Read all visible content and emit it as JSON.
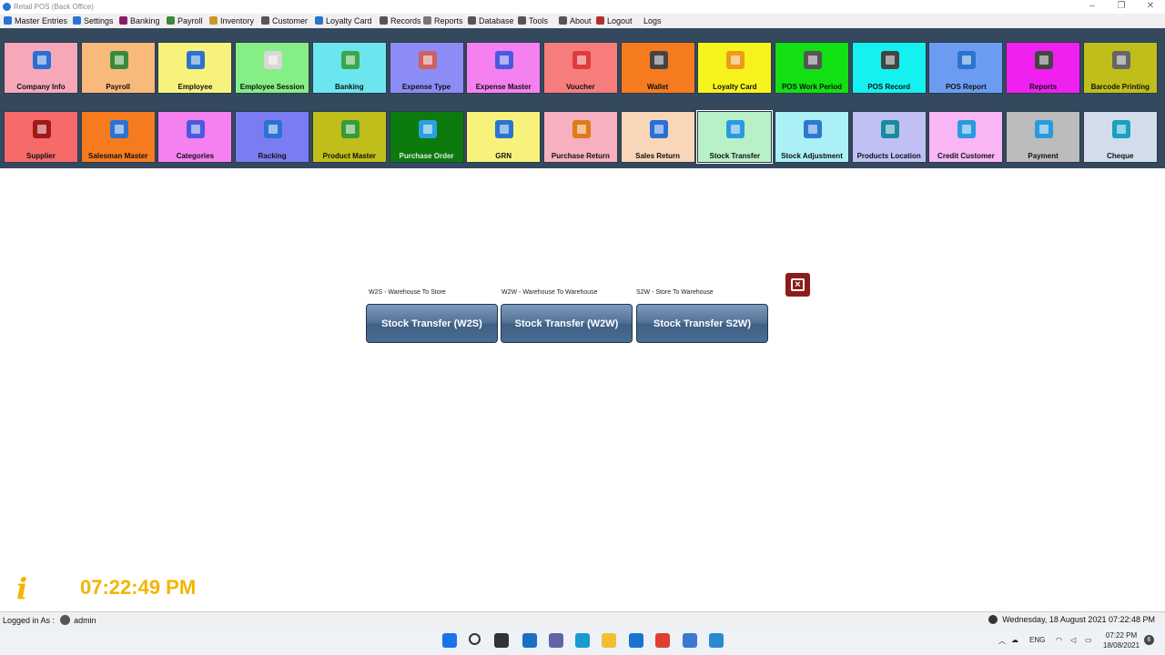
{
  "window": {
    "title": "Retail POS (Back Office)",
    "controls": [
      "–",
      "❐",
      "✕"
    ]
  },
  "menu": [
    {
      "label": "Master Entries",
      "icon": "globe-icon",
      "color": "#2a73d0"
    },
    {
      "label": "Settings",
      "icon": "globe-icon",
      "color": "#2a73d0"
    },
    {
      "label": "Banking",
      "icon": "bank-icon",
      "color": "#8b1c6a"
    },
    {
      "label": "Payroll",
      "icon": "payroll-icon",
      "color": "#3a8a3a"
    },
    {
      "label": "Inventory",
      "icon": "inventory-icon",
      "color": "#c79a2a"
    },
    {
      "label": "Customer",
      "icon": "customer-icon",
      "color": "#555555"
    },
    {
      "label": "Loyalty Card",
      "icon": "card-icon",
      "color": "#2a73d0"
    },
    {
      "label": "Records",
      "icon": "records-icon",
      "color": "#555555"
    },
    {
      "label": "Reports",
      "icon": "reports-icon",
      "color": "#777777"
    },
    {
      "label": "Database",
      "icon": "database-icon",
      "color": "#555555"
    },
    {
      "label": "Tools",
      "icon": "tools-icon",
      "color": "#555555"
    },
    {
      "label": "About",
      "icon": "about-icon",
      "color": "#555555"
    },
    {
      "label": "Logout",
      "icon": "logout-icon",
      "color": "#b03030"
    },
    {
      "label": "Logs",
      "icon": "",
      "color": ""
    }
  ],
  "tiles_row1": [
    {
      "label": "Company Info",
      "bg": "#f7a8b8",
      "icon": "building-icon",
      "ic": "#2a6fd6"
    },
    {
      "label": "Payroll",
      "bg": "#f9b97a",
      "icon": "money-envelope-icon",
      "ic": "#3a8a3a"
    },
    {
      "label": "Employee",
      "bg": "#f7f27c",
      "icon": "employee-add-icon",
      "ic": "#2a73d0"
    },
    {
      "label": "Employee Session",
      "bg": "#86ee86",
      "icon": "session-icon",
      "ic": "#d8d8d8"
    },
    {
      "label": "Banking",
      "bg": "#6be6ef",
      "icon": "dollar-icon",
      "ic": "#3aa84a"
    },
    {
      "label": "Expense Type",
      "bg": "#8c8cf7",
      "icon": "barcode-list-icon",
      "ic": "#d06060"
    },
    {
      "label": "Expense Master",
      "bg": "#f580f0",
      "icon": "list-icon",
      "ic": "#4a5ae0"
    },
    {
      "label": "Voucher",
      "bg": "#f77d7d",
      "icon": "gift-card-icon",
      "ic": "#e03a3a"
    },
    {
      "label": "Wallet",
      "bg": "#f57b1e",
      "icon": "wallet-icon",
      "ic": "#444444"
    },
    {
      "label": "Loyalty Card",
      "bg": "#f7f31c",
      "icon": "loyalty-card-icon",
      "ic": "#f09a1a"
    },
    {
      "label": "POS Work Period",
      "bg": "#12e012",
      "icon": "timer-icon",
      "ic": "#555555"
    },
    {
      "label": "POS Record",
      "bg": "#15f0f0",
      "icon": "cash-register-icon",
      "ic": "#444444"
    },
    {
      "label": "POS Report",
      "bg": "#6c9cf2",
      "icon": "report-doc-icon",
      "ic": "#2a73d0"
    },
    {
      "label": "Reports",
      "bg": "#f020f0",
      "icon": "clipboard-icon",
      "ic": "#444444"
    },
    {
      "label": "Barcode Printing",
      "bg": "#c0be1a",
      "icon": "barcode-scanner-icon",
      "ic": "#666666"
    }
  ],
  "tiles_row2": [
    {
      "label": "Supplier",
      "bg": "#f76a6a",
      "icon": "supplier-icon",
      "ic": "#a01818"
    },
    {
      "label": "Salesman Master",
      "bg": "#f57b1e",
      "icon": "salesman-icon",
      "ic": "#2a73d0"
    },
    {
      "label": "Categories",
      "bg": "#f580f0",
      "icon": "categories-icon",
      "ic": "#4a5ae0"
    },
    {
      "label": "Racking",
      "bg": "#7c7cf2",
      "icon": "racking-icon",
      "ic": "#2a73d0"
    },
    {
      "label": "Product Master",
      "bg": "#c0be1a",
      "icon": "product-box-icon",
      "ic": "#3a9a3a"
    },
    {
      "label": "Purchase Order",
      "bg": "#0d7a0d",
      "icon": "cart-upload-icon",
      "ic": "#2aa0e0"
    },
    {
      "label": "GRN",
      "bg": "#f7f27c",
      "icon": "grn-icon",
      "ic": "#2a73d0"
    },
    {
      "label": "Purchase Return",
      "bg": "#f7b0c0",
      "icon": "purchase-return-icon",
      "ic": "#e07a1a"
    },
    {
      "label": "Sales Return",
      "bg": "#f9d6b8",
      "icon": "return-arrow-icon",
      "ic": "#2a6fd6"
    },
    {
      "label": "Stock Transfer",
      "bg": "#b8f0c8",
      "icon": "swap-arrows-icon",
      "ic": "#2a9ae0"
    },
    {
      "label": "Stock Adjustment",
      "bg": "#aaf0f5",
      "icon": "adjust-arrows-icon",
      "ic": "#2a7ad0"
    },
    {
      "label": "Products Location",
      "bg": "#c0c0f5",
      "icon": "location-pin-icon",
      "ic": "#1a8aa0"
    },
    {
      "label": "Credit Customer",
      "bg": "#f8b6f5",
      "icon": "person-icon",
      "ic": "#2a9ae0"
    },
    {
      "label": "Payment",
      "bg": "#bcbcbc",
      "icon": "payment-icon",
      "ic": "#2a9ae0"
    },
    {
      "label": "Cheque",
      "bg": "#d2dcea",
      "icon": "cheque-icon",
      "ic": "#1aa0c0"
    }
  ],
  "transfer_options": [
    {
      "caption": "W2S - Warehouse To Store",
      "button": "Stock Transfer (W2S)"
    },
    {
      "caption": "W2W - Warehouse To Warehouse",
      "button": "Stock Transfer (W2W)"
    },
    {
      "caption": "S2W - Store To Warehouse",
      "button": "Stock Transfer S2W)"
    }
  ],
  "clock": "07:22:49 PM",
  "status": {
    "logged_in_label": "Logged in As :",
    "user": "admin",
    "datetime": "Wednesday, 18 August 2021 07:22:48 PM"
  },
  "taskbar": {
    "apps": [
      {
        "icon": "windows-start-icon",
        "color": "#1a73e8"
      },
      {
        "icon": "search-icon",
        "color": "#333333"
      },
      {
        "icon": "task-view-icon",
        "color": "#333333"
      },
      {
        "icon": "widgets-icon",
        "color": "#1a6fc0"
      },
      {
        "icon": "teams-chat-icon",
        "color": "#6264a7"
      },
      {
        "icon": "edge-icon",
        "color": "#1a9ad0"
      },
      {
        "icon": "file-explorer-icon",
        "color": "#f0c030"
      },
      {
        "icon": "mail-icon",
        "color": "#1a73d0"
      },
      {
        "icon": "chrome-icon",
        "color": "#e04030"
      },
      {
        "icon": "notepad-icon",
        "color": "#3a7ad0"
      },
      {
        "icon": "pos-app-icon",
        "color": "#2a8ad0"
      }
    ],
    "language": "ENG",
    "time": "07:22 PM",
    "date": "18/08/2021",
    "notifications": "6"
  }
}
